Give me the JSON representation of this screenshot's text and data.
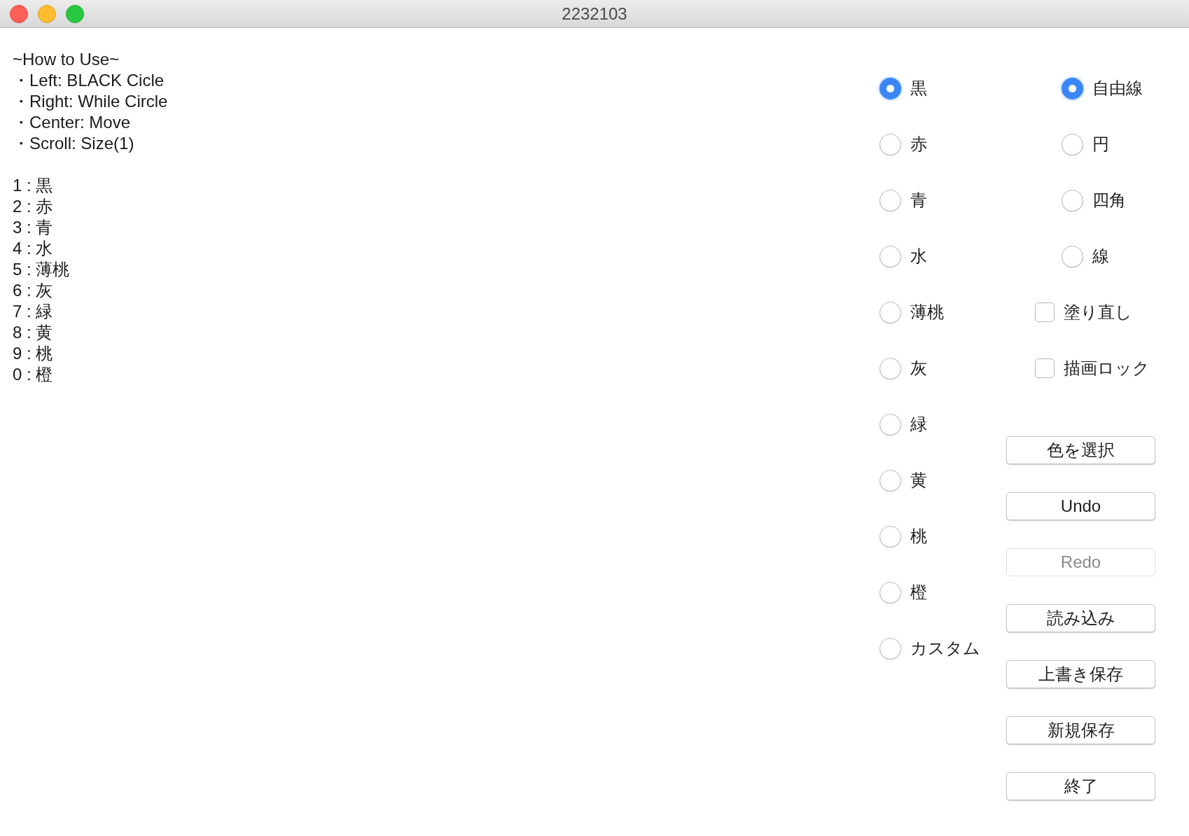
{
  "window": {
    "title": "2232103"
  },
  "instructions": [
    "~How to Use~",
    "・Left: BLACK Cicle",
    "・Right: While Circle",
    "・Center: Move",
    "・Scroll: Size(1)"
  ],
  "key_list": [
    "1 : 黒",
    "2 : 赤",
    "3 : 青",
    "4 : 水",
    "5 : 薄桃",
    "6 : 灰",
    "7 : 緑",
    "8 : 黄",
    "9 : 桃",
    "0 : 橙"
  ],
  "colors": [
    {
      "label": "黒",
      "selected": true
    },
    {
      "label": "赤",
      "selected": false
    },
    {
      "label": "青",
      "selected": false
    },
    {
      "label": "水",
      "selected": false
    },
    {
      "label": "薄桃",
      "selected": false
    },
    {
      "label": "灰",
      "selected": false
    },
    {
      "label": "緑",
      "selected": false
    },
    {
      "label": "黄",
      "selected": false
    },
    {
      "label": "桃",
      "selected": false
    },
    {
      "label": "橙",
      "selected": false
    },
    {
      "label": "カスタム",
      "selected": false
    }
  ],
  "shapes": [
    {
      "label": "自由線",
      "selected": true
    },
    {
      "label": "円",
      "selected": false
    },
    {
      "label": "四角",
      "selected": false
    },
    {
      "label": "線",
      "selected": false
    }
  ],
  "options": [
    {
      "label": "塗り直し",
      "checked": false
    },
    {
      "label": "描画ロック",
      "checked": false
    }
  ],
  "buttons": [
    {
      "label": "色を選択",
      "disabled": false
    },
    {
      "label": "Undo",
      "disabled": false
    },
    {
      "label": "Redo",
      "disabled": true
    },
    {
      "label": "読み込み",
      "disabled": false
    },
    {
      "label": "上書き保存",
      "disabled": false
    },
    {
      "label": "新規保存",
      "disabled": false
    },
    {
      "label": "終了",
      "disabled": false
    }
  ]
}
